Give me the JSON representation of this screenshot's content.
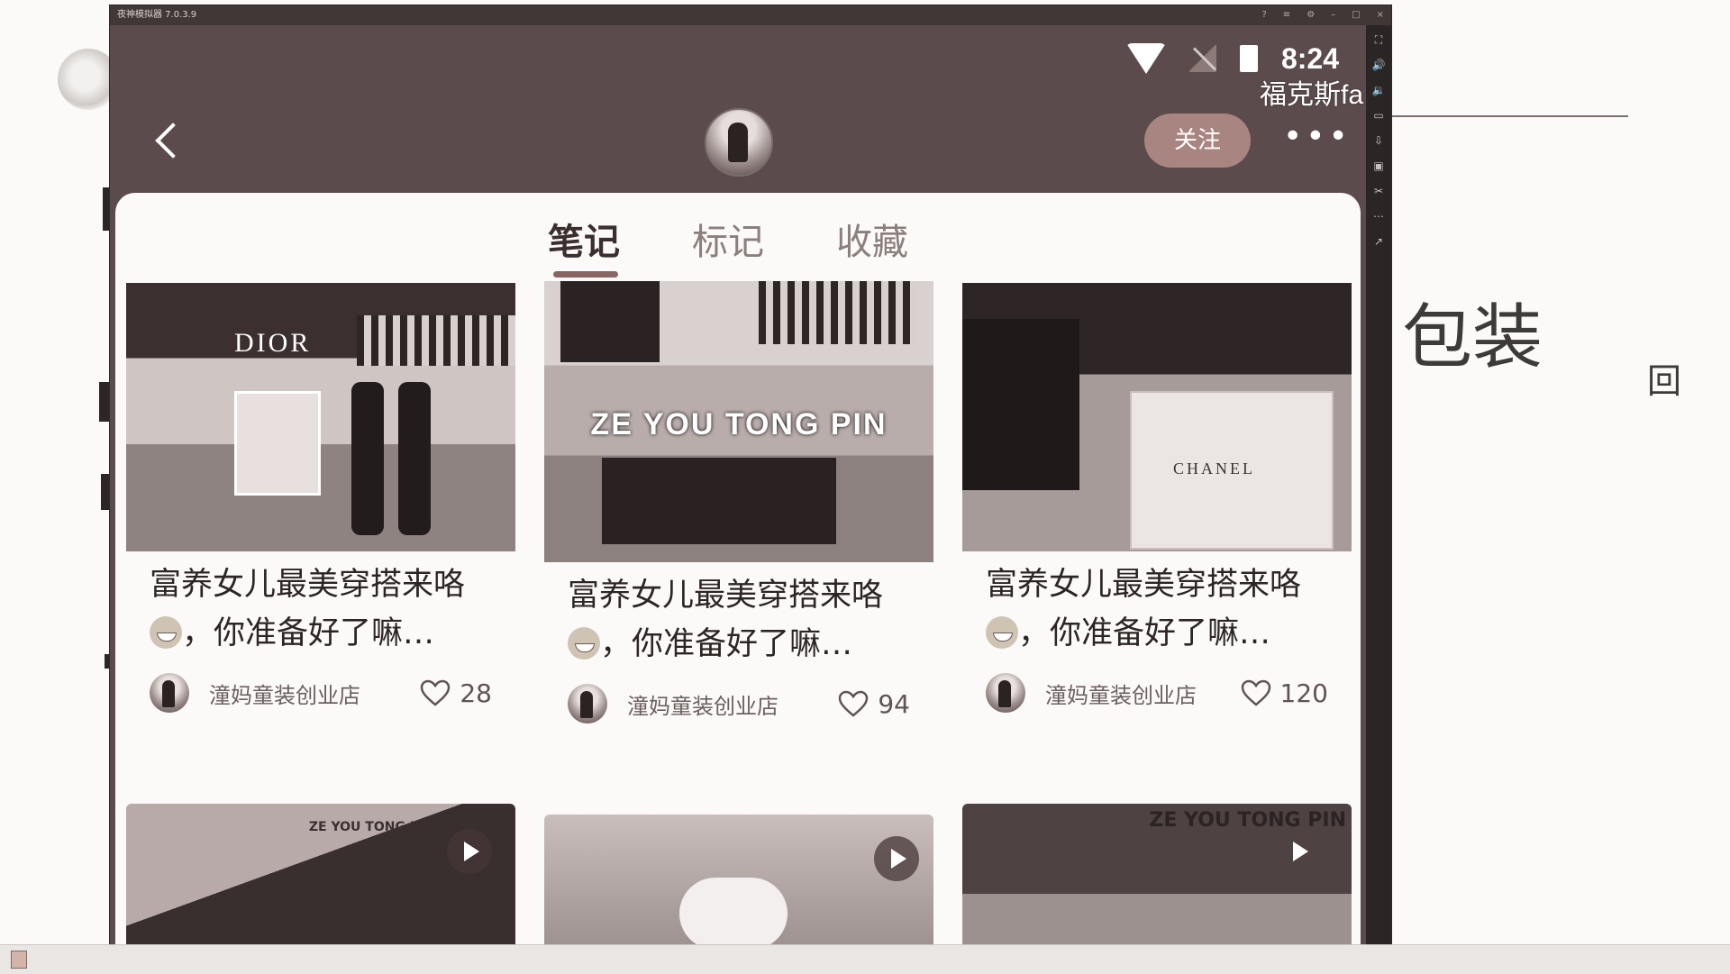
{
  "emulator": {
    "title": "夜神模拟器 7.0.3.9"
  },
  "status": {
    "time": "8:24",
    "overlay_text": "福克斯fa"
  },
  "header": {
    "follow_label": "关注",
    "more_label": "•••"
  },
  "tabs": [
    {
      "label": "笔记",
      "active": true
    },
    {
      "label": "标记",
      "active": false
    },
    {
      "label": "收藏",
      "active": false
    }
  ],
  "cards": [
    {
      "title": "富养女儿最美穿搭来咯",
      "title2": "，你准备好了嘛…",
      "author": "潼妈童装创业店",
      "likes": "28",
      "thumb_text": "",
      "brand": "DIOR"
    },
    {
      "title": "富养女儿最美穿搭来咯",
      "title2": "，你准备好了嘛…",
      "author": "潼妈童装创业店",
      "likes": "94",
      "thumb_text": "ZE YOU TONG PIN",
      "brand": ""
    },
    {
      "title": "富养女儿最美穿搭来咯",
      "title2": "，你准备好了嘛…",
      "author": "潼妈童装创业店",
      "likes": "120",
      "thumb_text": "",
      "brand": "CHANEL"
    }
  ],
  "video_cards": [
    {
      "thumb_text": "ZE YOU TONG PIN",
      "has_play": true
    },
    {
      "thumb_text": "",
      "has_play": true
    },
    {
      "thumb_text": "ZE YOU TONG PIN",
      "has_play": true
    }
  ],
  "whiteboard": {
    "scribble_1": "包装",
    "scribble_2": "回"
  }
}
